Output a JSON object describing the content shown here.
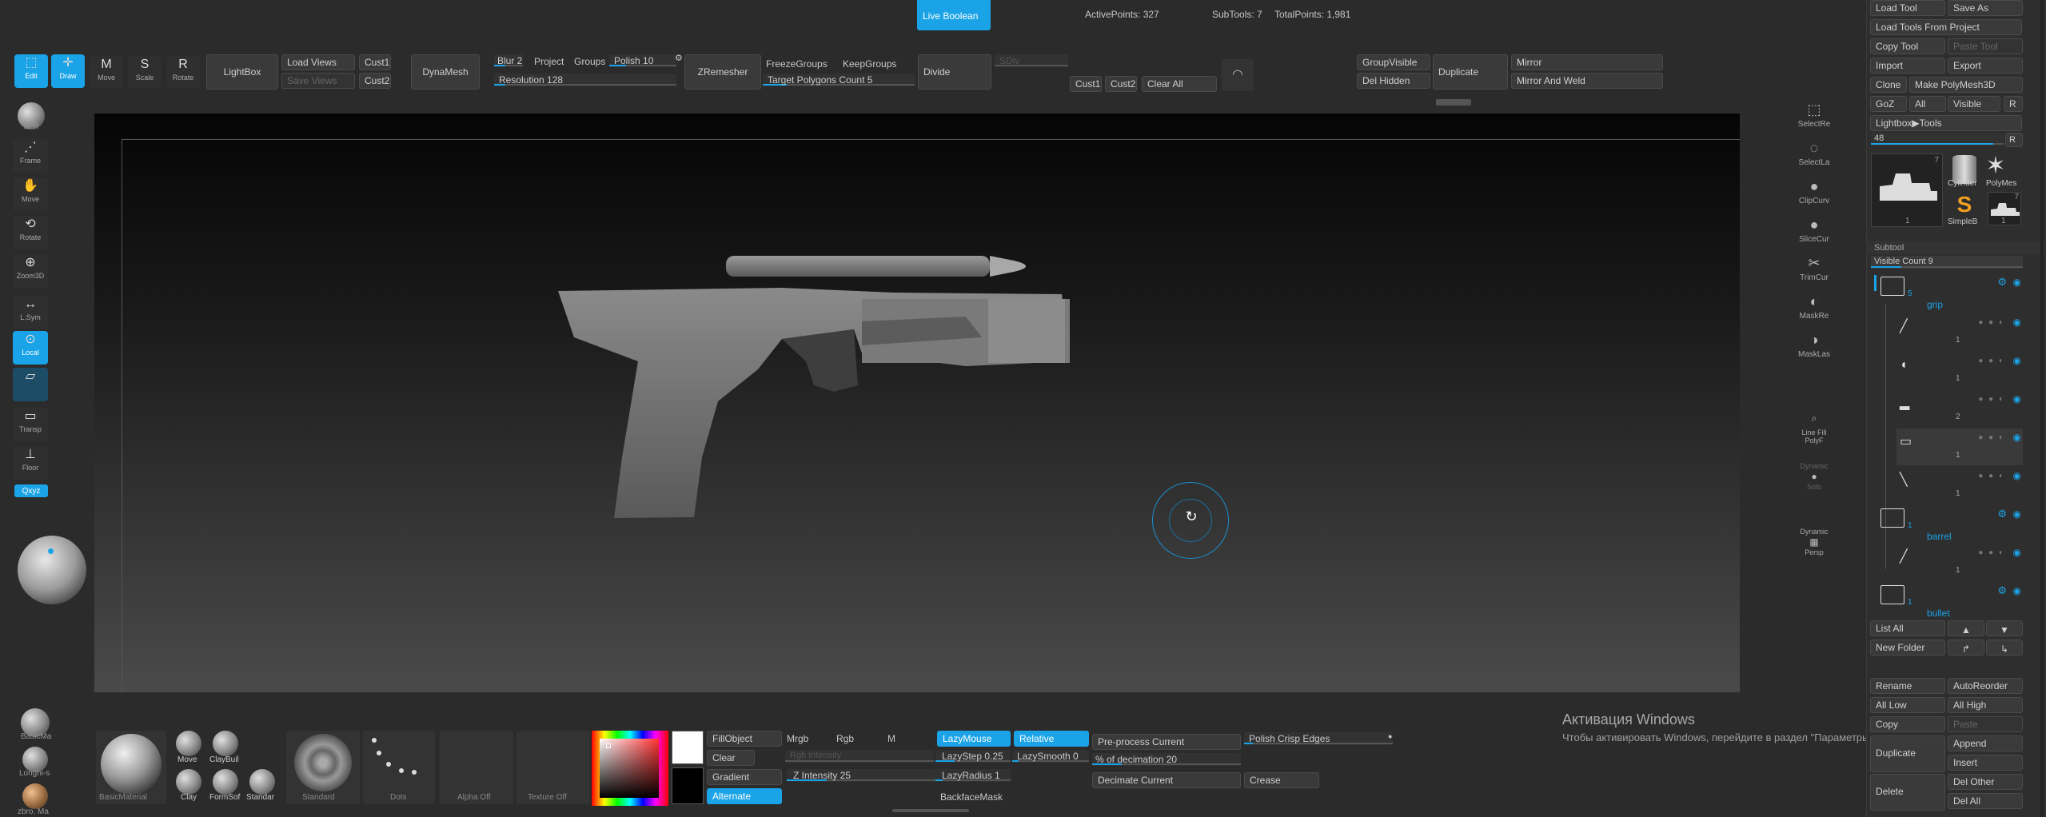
{
  "top": {
    "live_boolean": "Live Boolean",
    "active_points": "ActivePoints: 327",
    "subtools": "SubTools: 7",
    "total_points": "TotalPoints: 1,981"
  },
  "toolbar": {
    "edit": "Edit",
    "draw": "Draw",
    "move": "Move",
    "scale": "Scale",
    "rotate": "Rotate",
    "lightbox": "LightBox",
    "load_views": "Load Views",
    "save_views": "Save Views",
    "cust1": "Cust1",
    "cust2": "Cust2",
    "dynamesh": "DynaMesh",
    "blur": "Blur 2",
    "project": "Project",
    "groups": "Groups",
    "polish": "Polish 10",
    "resolution": "Resolution 128",
    "zremesher": "ZRemesher",
    "freezegroups": "FreezeGroups",
    "keepgroups": "KeepGroups",
    "target_polygons": "Target Polygons Count 5",
    "divide": "Divide",
    "sdiv": "SDiv",
    "cust1b": "Cust1",
    "cust2b": "Cust2",
    "clear_all": "Clear All",
    "group_visible": "GroupVisible",
    "del_hidden": "Del Hidden",
    "duplicate": "Duplicate",
    "mirror": "Mirror",
    "mirror_weld": "Mirror And Weld"
  },
  "left_tools": [
    {
      "label": "BPR",
      "icon": "render-icon"
    },
    {
      "label": "Frame",
      "icon": "frame-icon"
    },
    {
      "label": "Move",
      "icon": "hand-icon"
    },
    {
      "label": "Rotate",
      "icon": "rotate-icon"
    },
    {
      "label": "Zoom3D",
      "icon": "zoom-icon"
    },
    {
      "label": "L.Sym",
      "icon": "symmetry-icon"
    },
    {
      "label": "Local",
      "icon": "local-icon"
    },
    {
      "label": "",
      "icon": "perspective-icon"
    },
    {
      "label": "Transp",
      "icon": "transparency-icon"
    },
    {
      "label": "Floor",
      "icon": "floor-icon"
    },
    {
      "label": "Qxyz",
      "icon": "axis-icon"
    }
  ],
  "right_tools": [
    {
      "label": "SelectRe",
      "icon": "select-rect-icon"
    },
    {
      "label": "SelectLa",
      "icon": "select-lasso-icon"
    },
    {
      "label": "ClipCurv",
      "icon": "clip-curve-icon"
    },
    {
      "label": "SliceCur",
      "icon": "slice-curve-icon"
    },
    {
      "label": "TrimCur",
      "icon": "trim-curve-icon"
    },
    {
      "label": "MaskRe",
      "icon": "mask-rect-icon"
    },
    {
      "label": "MaskLas",
      "icon": "mask-lasso-icon"
    },
    {
      "label": "Line Fill",
      "icon": "line-fill-icon"
    },
    {
      "label": "PolyF",
      "icon": "polyframe-icon"
    },
    {
      "label": "Dynamic",
      "icon": "dynamic-icon"
    },
    {
      "label": "Solo",
      "icon": "solo-icon"
    },
    {
      "label": "Dynamic",
      "icon": "dynamic2-icon"
    },
    {
      "label": "Persp",
      "icon": "persp-icon"
    }
  ],
  "left_brushes": [
    {
      "label": "BasicMa"
    },
    {
      "label": "Longhi-s"
    },
    {
      "label": "zbro. Ma"
    }
  ],
  "bottom": {
    "material": "BasicMaterial",
    "brushes": [
      "Move",
      "ClayBuil",
      "Clay",
      "FormSof",
      "Standar"
    ],
    "standard": "Standard",
    "dots": "Dots",
    "alpha_off": "Alpha Off",
    "texture_off": "Texture Off",
    "fill_object": "FillObject",
    "clear": "Clear",
    "gradient": "Gradient",
    "alternate": "Alternate",
    "mrgb": "Mrgb",
    "rgb": "Rgb",
    "m": "M",
    "rgb_intensity": "Rgb Intensity",
    "z_intensity": "Z Intensity 25",
    "lazymouse": "LazyMouse",
    "relative": "Relative",
    "lazystep": "LazyStep 0.25",
    "lazysmooth": "LazySmooth 0",
    "lazyradius": "LazyRadius 1",
    "backface_mask": "BackfaceMask",
    "preprocess": "Pre-process Current",
    "pct_decimation": "% of decimation 20",
    "decimate_current": "Decimate Current",
    "polish_crisp": "Polish Crisp Edges",
    "crease": "Crease"
  },
  "watermark": {
    "title": "Активация Windows",
    "body": "Чтобы активировать Windows, перейдите в раздел \"Параметры\"."
  },
  "tool_panel": {
    "load_tool": "Load Tool",
    "save_as": "Save As",
    "load_from_project": "Load Tools From Project",
    "copy_tool": "Copy Tool",
    "paste_tool": "Paste Tool",
    "import": "Import",
    "export": "Export",
    "clone": "Clone",
    "make_polymesh": "Make PolyMesh3D",
    "goz": "GoZ",
    "all": "All",
    "visible": "Visible",
    "r": "R",
    "lightbox_tools": "Lightbox▶Tools",
    "size": "48",
    "r2": "R",
    "thumb_count": "7",
    "cylinder": "Cylinder",
    "polymesh": "PolyMes",
    "simpleb": "SimpleB",
    "thumb_one": "1",
    "thumb_one_b": "1",
    "thumb_seven": "7"
  },
  "subtool": {
    "header": "Subtool",
    "visible_count": "Visible Count 9",
    "rows": [
      {
        "count": "5",
        "name": "grip",
        "folder": true
      },
      {
        "count": "1",
        "name": "",
        "folder": false
      },
      {
        "count": "1",
        "name": "",
        "folder": false
      },
      {
        "count": "2",
        "name": "",
        "folder": false
      },
      {
        "count": "1",
        "name": "",
        "folder": false
      },
      {
        "count": "1",
        "name": "",
        "folder": false
      },
      {
        "count": "1",
        "name": "barrel",
        "folder": true
      },
      {
        "count": "1",
        "name": "",
        "folder": false
      },
      {
        "count": "1",
        "name": "bullet",
        "folder": true
      }
    ],
    "list_all": "List All",
    "new_folder": "New Folder",
    "rename": "Rename",
    "autoreorder": "AutoReorder",
    "all_low": "All Low",
    "all_high": "All High",
    "copy": "Copy",
    "paste": "Paste",
    "duplicate": "Duplicate",
    "append": "Append",
    "insert": "Insert",
    "delete": "Delete",
    "del_other": "Del Other",
    "del_all": "Del All"
  },
  "colors": {
    "accent": "#1aa3e6",
    "bg": "#2b2b2b",
    "canvas_top": "#050505",
    "canvas_bottom": "#4a4a4a"
  }
}
